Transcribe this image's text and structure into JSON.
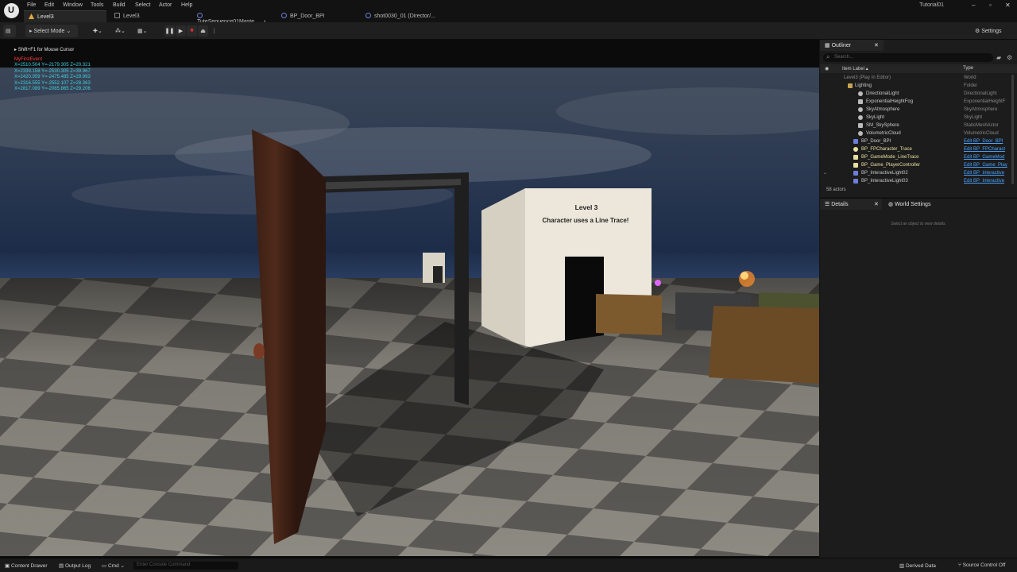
{
  "menu": {
    "items": [
      "File",
      "Edit",
      "Window",
      "Tools",
      "Build",
      "Select",
      "Actor",
      "Help"
    ]
  },
  "tabs": [
    {
      "label": "Level3",
      "active": true
    },
    {
      "label": "Level3",
      "active": false
    },
    {
      "label": "TuteSequence01Maste...",
      "active": false
    },
    {
      "label": "BP_Door_BPI",
      "active": false
    },
    {
      "label": "shot0030_01 (Director/...",
      "active": false
    }
  ],
  "project_name": "Tutorial01",
  "window_controls": {
    "minimize": "–",
    "maximize": "▫",
    "close": "✕"
  },
  "toolbar": {
    "mode_label": "Select Mode",
    "settings_label": "Settings"
  },
  "play_controls": {
    "pause": "❚❚",
    "step": "▶",
    "stop": "■",
    "eject": "⏏",
    "more": "⋮"
  },
  "viewport": {
    "hint": "Shift+F1 for Mouse Cursor",
    "event_text": "MyFirstEvent",
    "coords": [
      "X=2510.504 Y=-2179.305 Z=20.321",
      "X=2339.158 Y=-2530.305 Z=39.967",
      "X=2420.959 Y=-2475.485 Z=29.993",
      "X=2316.555 Y=-2552.107 Z=28.363",
      "X=2817.089 Y=-2085.865 Z=29.206"
    ],
    "sign_line1": "Level 3",
    "sign_line2": "Character uses a Line Trace!"
  },
  "outliner": {
    "tab_label": "Outliner",
    "search_placeholder": "Search...",
    "col_label": "Item Label ▴",
    "col_type": "Type",
    "rows": [
      {
        "label": "Level3 (Play In Editor)",
        "type": "World"
      },
      {
        "label": "Lighting",
        "type": "Folder"
      },
      {
        "label": "DirectionalLight",
        "type": "DirectionalLight"
      },
      {
        "label": "ExponentialHeightFog",
        "type": "ExponentialHeightF"
      },
      {
        "label": "SkyAtmosphere",
        "type": "SkyAtmosphere"
      },
      {
        "label": "SkyLight",
        "type": "SkyLight"
      },
      {
        "label": "SM_SkySphere",
        "type": "StaticMeshActor"
      },
      {
        "label": "VolumetricCloud",
        "type": "VolumetricCloud"
      },
      {
        "label": "BP_Door_BPI",
        "type": "Edit BP_Door_BPI"
      },
      {
        "label": "BP_FPCharacter_Trace",
        "type": "Edit BP_FPCharact"
      },
      {
        "label": "BP_GameMode_LineTrace",
        "type": "Edit BP_GameMod"
      },
      {
        "label": "BP_Game_PlayerController",
        "type": "Edit BP_Game_Play"
      },
      {
        "label": "BP_InteractiveLight02",
        "type": "Edit BP_Interactive"
      },
      {
        "label": "BP_InteractiveLight03",
        "type": "Edit BP_Interactive"
      }
    ],
    "actor_count": "58 actors"
  },
  "details": {
    "tab_label": "Details",
    "world_settings_label": "World Settings",
    "empty_text": "Select an object to view details."
  },
  "statusbar": {
    "content_drawer": "Content Drawer",
    "output_log": "Output Log",
    "cmd": "Cmd",
    "console_placeholder": "Enter Console Command",
    "derived_data": "Derived Data",
    "source_control": "Source Control Off"
  },
  "colors": {
    "accent_link": "#4aa3ff",
    "hud_event": "#ff3b3b",
    "hud_coord": "#3fd0e0",
    "stop_red": "#d93030",
    "tab_level_icon": "#e3a83a"
  }
}
